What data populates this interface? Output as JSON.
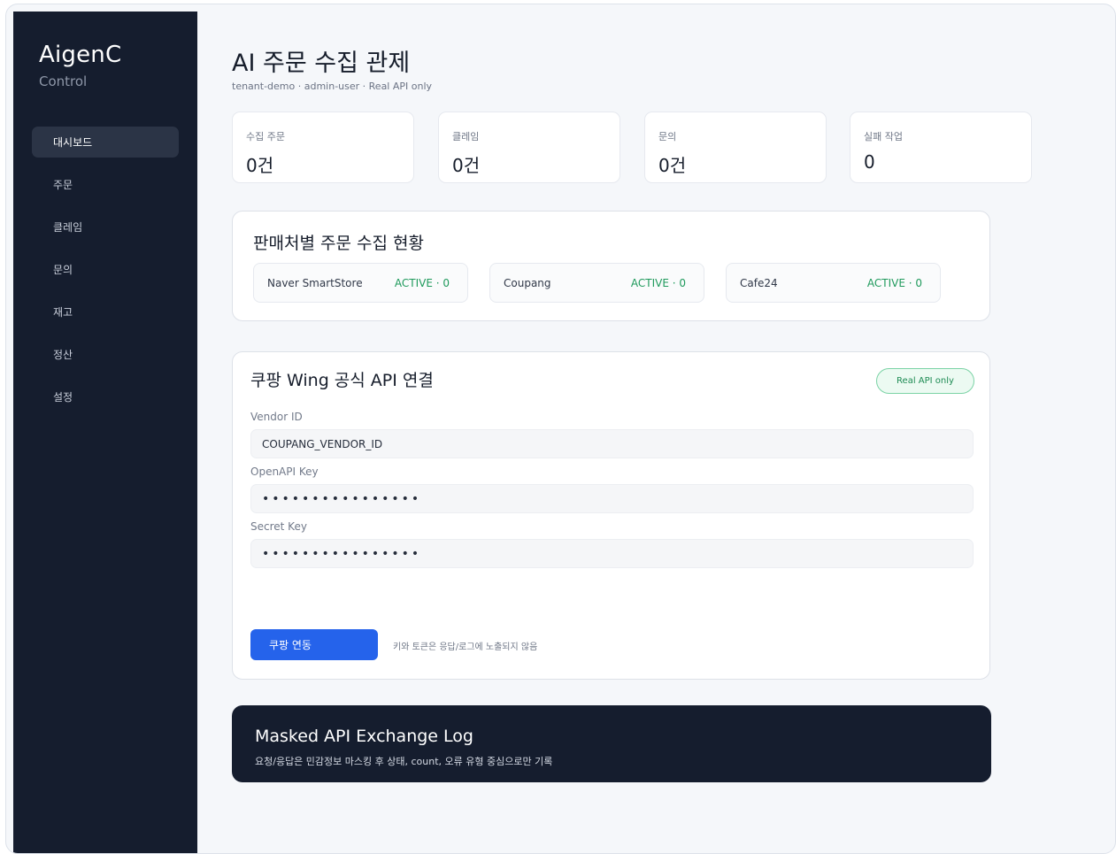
{
  "sidebar": {
    "brand": "AigenC",
    "brand_sub": "Control",
    "items": [
      {
        "label": "대시보드",
        "active": true
      },
      {
        "label": "주문"
      },
      {
        "label": "클레임"
      },
      {
        "label": "문의"
      },
      {
        "label": "재고"
      },
      {
        "label": "정산"
      },
      {
        "label": "설정"
      }
    ]
  },
  "header": {
    "title": "AI 주문 수집 관제",
    "subtitle": "tenant-demo · admin-user · Real API only"
  },
  "stats": [
    {
      "label": "수집 주문",
      "value": "0건"
    },
    {
      "label": "클레임",
      "value": "0건"
    },
    {
      "label": "문의",
      "value": "0건"
    },
    {
      "label": "실패 작업",
      "value": "0"
    }
  ],
  "channels": {
    "title": "판매처별 주문 수집 현황",
    "items": [
      {
        "name": "Naver SmartStore",
        "status": "ACTIVE · 0"
      },
      {
        "name": "Coupang",
        "status": "ACTIVE · 0"
      },
      {
        "name": "Cafe24",
        "status": "ACTIVE · 0"
      }
    ]
  },
  "coupang": {
    "title": "쿠팡 Wing 공식 API 연결",
    "badge": "Real API only",
    "vendor_label": "Vendor ID",
    "vendor_value": "COUPANG_VENDOR_ID",
    "openapi_label": "OpenAPI Key",
    "openapi_value": "••••••••••••••••",
    "secret_label": "Secret Key",
    "secret_value": "••••••••••••••••",
    "connect_label": "쿠팡 연동",
    "hint": "키와 토큰은 응답/로그에 노출되지 않음"
  },
  "log": {
    "title": "Masked API Exchange Log",
    "subtitle": "요청/응답은 민감정보 마스킹 후 상태, count, 오류 유형 중심으로만 기록"
  },
  "colors": {
    "sidebar_bg": "#151d2e",
    "accent": "#2563eb",
    "status_green": "#1f9a5c"
  }
}
